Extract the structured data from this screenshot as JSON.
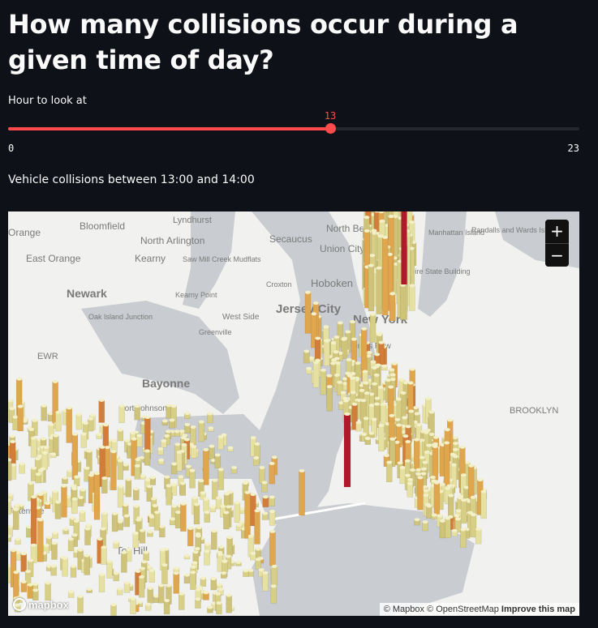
{
  "header": {
    "title": "How many collisions occur during a given time of day?"
  },
  "slider": {
    "label": "Hour to look at",
    "min": 0,
    "max": 23,
    "value": 13,
    "min_label": "0",
    "max_label": "23",
    "value_label": "13",
    "color": "#ff4b4b"
  },
  "caption": "Vehicle collisions between 13:00 and 14:00",
  "map": {
    "zoom_in": "+",
    "zoom_out": "−",
    "attribution": "© Mapbox © OpenStreetMap",
    "improve": "Improve this map",
    "logo": "mapbox",
    "places": [
      "Orange",
      "Bloomfield",
      "Lyndhurst",
      "North Bergen",
      "Manhattan Island",
      "Randalls and Wards Islands",
      "North Arlington",
      "Secaucus",
      "Union City",
      "East Orange",
      "Kearny",
      "Saw Mill Creek Mudflats",
      "Newark",
      "Croxton",
      "Hoboken",
      "Empire State Building",
      "Kearny Point",
      "Jersey City",
      "New York",
      "Oak Island Junction",
      "West Side",
      "Greenville",
      "Colonels Row",
      "EWR",
      "Bayonne",
      "BROOKLYN",
      "Port Johnson",
      "Tottenville",
      "Tot Hill"
    ]
  }
}
